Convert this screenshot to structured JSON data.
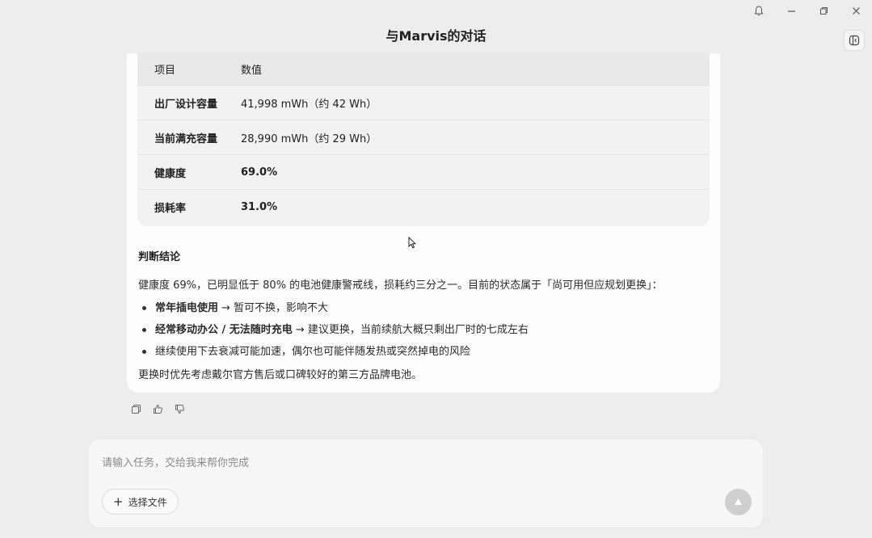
{
  "window": {
    "title": "与Marvis的对话"
  },
  "table": {
    "headers": [
      "项目",
      "数值"
    ],
    "rows": [
      {
        "label": "出厂设计容量",
        "value": "41,998 mWh（约 42 Wh）",
        "bold": false
      },
      {
        "label": "当前满充容量",
        "value": "28,990 mWh（约 29 Wh）",
        "bold": false
      },
      {
        "label": "健康度",
        "value": "69.0%",
        "bold": true
      },
      {
        "label": "损耗率",
        "value": "31.0%",
        "bold": true
      }
    ]
  },
  "message": {
    "conclusion_title": "判断结论",
    "summary": "健康度 69%，已明显低于 80% 的电池健康警戒线，损耗约三分之一。目前的状态属于「尚可用但应规划更换」：",
    "bullets": [
      {
        "bold": "常年插电使用",
        "text": "→ 暂可不换，影响不大"
      },
      {
        "bold": "经常移动办公 / 无法随时充电",
        "text": "→ 建议更换，当前续航大概只剩出厂时的七成左右"
      },
      {
        "bold": "",
        "text": "继续使用下去衰减可能加速，偶尔也可能伴随发热或突然掉电的风险"
      }
    ],
    "closing": "更换时优先考虑戴尔官方售后或口碑较好的第三方品牌电池。"
  },
  "input": {
    "placeholder": "请输入任务，交给我来帮你完成",
    "file_button_label": "选择文件"
  }
}
